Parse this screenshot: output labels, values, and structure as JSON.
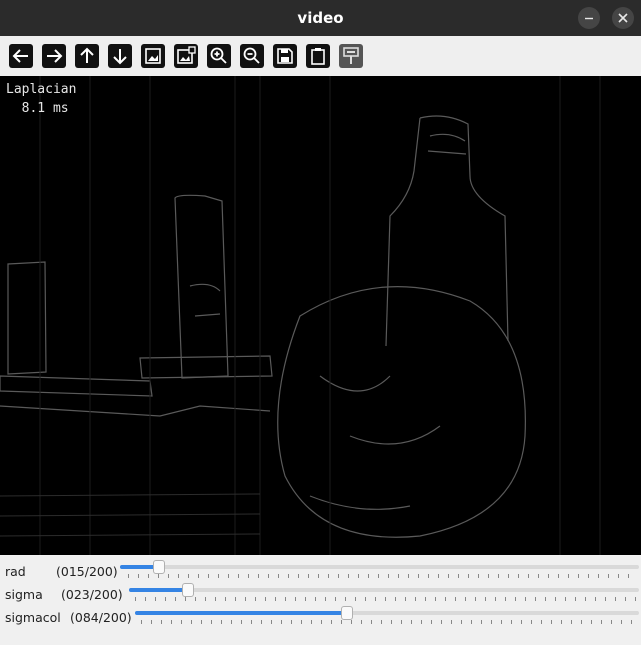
{
  "window": {
    "title": "video"
  },
  "toolbar": {
    "buttons": [
      {
        "icon": "arrow-left-icon"
      },
      {
        "icon": "arrow-right-icon"
      },
      {
        "icon": "arrow-up-icon"
      },
      {
        "icon": "arrow-down-icon"
      },
      {
        "icon": "image-icon"
      },
      {
        "icon": "image-save-icon"
      },
      {
        "icon": "zoom-in-icon"
      },
      {
        "icon": "zoom-out-icon"
      },
      {
        "icon": "save-icon"
      },
      {
        "icon": "clipboard-icon"
      },
      {
        "icon": "properties-icon"
      }
    ]
  },
  "view": {
    "filter": "Laplacian",
    "timing": "8.1 ms"
  },
  "sliders": [
    {
      "name": "rad",
      "display": "(015/200)",
      "value": 15,
      "max": 200
    },
    {
      "name": "sigma",
      "display": "(023/200)",
      "value": 23,
      "max": 200
    },
    {
      "name": "sigmacol",
      "display": "(084/200)",
      "value": 84,
      "max": 200
    }
  ],
  "colors": {
    "accent": "#3584e4",
    "titlebar": "#2b2b2b"
  }
}
